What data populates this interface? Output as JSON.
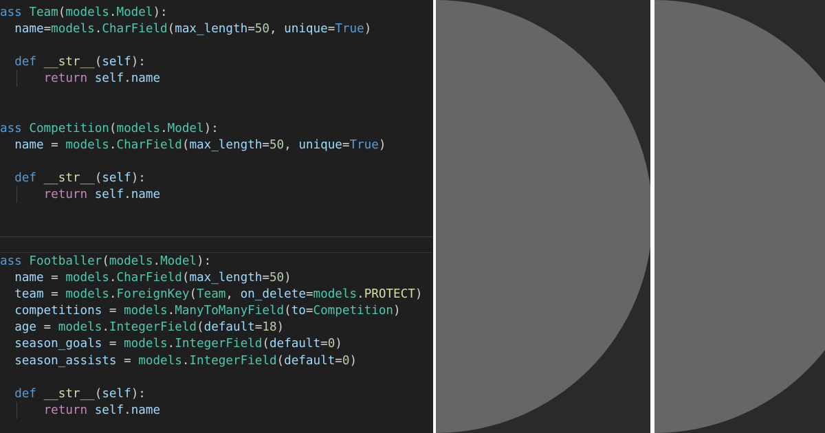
{
  "colors": {
    "editor_bg": "#1f1f1f",
    "panel_bg": "#2a2a2a",
    "half_circle": "#666666",
    "separator": "#ffffff",
    "keyword": "#569cd6",
    "flow_keyword": "#c586c0",
    "class_name": "#4ec9b0",
    "function_name": "#dcdcaa",
    "parameter": "#9cdcfe",
    "number": "#b5cea8",
    "plain": "#d4d4d4"
  },
  "code": {
    "blocks": [
      {
        "lines": [
          [
            [
              "keyword",
              "ass "
            ],
            [
              "class",
              "Team"
            ],
            [
              "plain",
              "("
            ],
            [
              "class",
              "models"
            ],
            [
              "plain",
              "."
            ],
            [
              "class",
              "Model"
            ],
            [
              "plain",
              "):"
            ]
          ],
          [
            [
              "plain",
              "  "
            ],
            [
              "param",
              "name"
            ],
            [
              "op",
              "="
            ],
            [
              "class",
              "models"
            ],
            [
              "plain",
              "."
            ],
            [
              "class",
              "CharField"
            ],
            [
              "plain",
              "("
            ],
            [
              "param",
              "max_length"
            ],
            [
              "op",
              "="
            ],
            [
              "number",
              "50"
            ],
            [
              "plain",
              ", "
            ],
            [
              "param",
              "unique"
            ],
            [
              "op",
              "="
            ],
            [
              "const",
              "True"
            ],
            [
              "plain",
              ")"
            ]
          ],
          [],
          [
            [
              "plain",
              "  "
            ],
            [
              "keyword",
              "def "
            ],
            [
              "func",
              "__str__"
            ],
            [
              "plain",
              "("
            ],
            [
              "self",
              "self"
            ],
            [
              "plain",
              "):"
            ]
          ],
          [
            [
              "plain",
              "      "
            ],
            [
              "flow",
              "return "
            ],
            [
              "self",
              "self"
            ],
            [
              "plain",
              "."
            ],
            [
              "param",
              "name"
            ]
          ],
          [],
          [],
          [
            [
              "keyword",
              "ass "
            ],
            [
              "class",
              "Competition"
            ],
            [
              "plain",
              "("
            ],
            [
              "class",
              "models"
            ],
            [
              "plain",
              "."
            ],
            [
              "class",
              "Model"
            ],
            [
              "plain",
              "):"
            ]
          ],
          [
            [
              "plain",
              "  "
            ],
            [
              "param",
              "name"
            ],
            [
              "op",
              " = "
            ],
            [
              "class",
              "models"
            ],
            [
              "plain",
              "."
            ],
            [
              "class",
              "CharField"
            ],
            [
              "plain",
              "("
            ],
            [
              "param",
              "max_length"
            ],
            [
              "op",
              "="
            ],
            [
              "number",
              "50"
            ],
            [
              "plain",
              ", "
            ],
            [
              "param",
              "unique"
            ],
            [
              "op",
              "="
            ],
            [
              "const",
              "True"
            ],
            [
              "plain",
              ")"
            ]
          ],
          [],
          [
            [
              "plain",
              "  "
            ],
            [
              "keyword",
              "def "
            ],
            [
              "func",
              "__str__"
            ],
            [
              "plain",
              "("
            ],
            [
              "self",
              "self"
            ],
            [
              "plain",
              "):"
            ]
          ],
          [
            [
              "plain",
              "      "
            ],
            [
              "flow",
              "return "
            ],
            [
              "self",
              "self"
            ],
            [
              "plain",
              "."
            ],
            [
              "param",
              "name"
            ]
          ]
        ]
      },
      {
        "lines": [
          [
            [
              "keyword",
              "ass "
            ],
            [
              "class",
              "Footballer"
            ],
            [
              "plain",
              "("
            ],
            [
              "class",
              "models"
            ],
            [
              "plain",
              "."
            ],
            [
              "class",
              "Model"
            ],
            [
              "plain",
              "):"
            ]
          ],
          [
            [
              "plain",
              "  "
            ],
            [
              "param",
              "name"
            ],
            [
              "op",
              " = "
            ],
            [
              "class",
              "models"
            ],
            [
              "plain",
              "."
            ],
            [
              "class",
              "CharField"
            ],
            [
              "plain",
              "("
            ],
            [
              "param",
              "max_length"
            ],
            [
              "op",
              "="
            ],
            [
              "number",
              "50"
            ],
            [
              "plain",
              ")"
            ]
          ],
          [
            [
              "plain",
              "  "
            ],
            [
              "param",
              "team"
            ],
            [
              "op",
              " = "
            ],
            [
              "class",
              "models"
            ],
            [
              "plain",
              "."
            ],
            [
              "class",
              "ForeignKey"
            ],
            [
              "plain",
              "("
            ],
            [
              "class",
              "Team"
            ],
            [
              "plain",
              ", "
            ],
            [
              "param",
              "on_delete"
            ],
            [
              "op",
              "="
            ],
            [
              "class",
              "models"
            ],
            [
              "plain",
              "."
            ],
            [
              "enum",
              "PROTECT"
            ],
            [
              "plain",
              ")"
            ]
          ],
          [
            [
              "plain",
              "  "
            ],
            [
              "param",
              "competitions"
            ],
            [
              "op",
              " = "
            ],
            [
              "class",
              "models"
            ],
            [
              "plain",
              "."
            ],
            [
              "class",
              "ManyToManyField"
            ],
            [
              "plain",
              "("
            ],
            [
              "param",
              "to"
            ],
            [
              "op",
              "="
            ],
            [
              "class",
              "Competition"
            ],
            [
              "plain",
              ")"
            ]
          ],
          [
            [
              "plain",
              "  "
            ],
            [
              "param",
              "age"
            ],
            [
              "op",
              " = "
            ],
            [
              "class",
              "models"
            ],
            [
              "plain",
              "."
            ],
            [
              "class",
              "IntegerField"
            ],
            [
              "plain",
              "("
            ],
            [
              "param",
              "default"
            ],
            [
              "op",
              "="
            ],
            [
              "number",
              "18"
            ],
            [
              "plain",
              ")"
            ]
          ],
          [
            [
              "plain",
              "  "
            ],
            [
              "param",
              "season_goals"
            ],
            [
              "op",
              " = "
            ],
            [
              "class",
              "models"
            ],
            [
              "plain",
              "."
            ],
            [
              "class",
              "IntegerField"
            ],
            [
              "plain",
              "("
            ],
            [
              "param",
              "default"
            ],
            [
              "op",
              "="
            ],
            [
              "number",
              "0"
            ],
            [
              "plain",
              ")"
            ]
          ],
          [
            [
              "plain",
              "  "
            ],
            [
              "param",
              "season_assists"
            ],
            [
              "op",
              " = "
            ],
            [
              "class",
              "models"
            ],
            [
              "plain",
              "."
            ],
            [
              "class",
              "IntegerField"
            ],
            [
              "plain",
              "("
            ],
            [
              "param",
              "default"
            ],
            [
              "op",
              "="
            ],
            [
              "number",
              "0"
            ],
            [
              "plain",
              ")"
            ]
          ],
          [],
          [
            [
              "plain",
              "  "
            ],
            [
              "keyword",
              "def "
            ],
            [
              "func",
              "__str__"
            ],
            [
              "plain",
              "("
            ],
            [
              "self",
              "self"
            ],
            [
              "plain",
              "):"
            ]
          ],
          [
            [
              "plain",
              "      "
            ],
            [
              "flow",
              "return "
            ],
            [
              "self",
              "self"
            ],
            [
              "plain",
              "."
            ],
            [
              "param",
              "name"
            ]
          ]
        ]
      }
    ]
  },
  "panels": [
    {
      "shape": "half-circle",
      "color": "#666666"
    },
    {
      "shape": "half-circle",
      "color": "#666666"
    }
  ]
}
